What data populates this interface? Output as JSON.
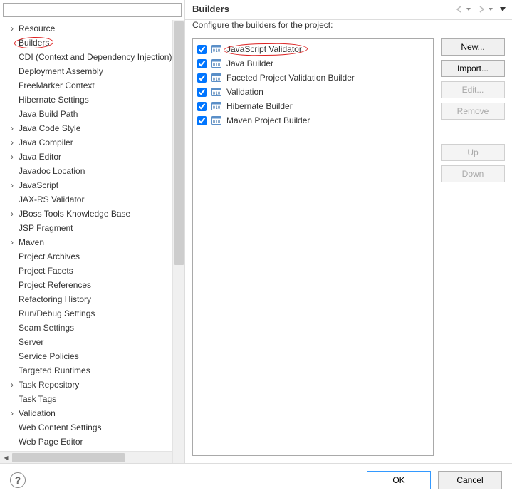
{
  "tree": {
    "filter_value": "",
    "items": [
      {
        "label": "Resource",
        "expandable": true
      },
      {
        "label": "Builders",
        "expandable": false,
        "highlighted": true
      },
      {
        "label": "CDI (Context and Dependency Injection)",
        "expandable": false
      },
      {
        "label": "Deployment Assembly",
        "expandable": false
      },
      {
        "label": "FreeMarker Context",
        "expandable": false
      },
      {
        "label": "Hibernate Settings",
        "expandable": false
      },
      {
        "label": "Java Build Path",
        "expandable": false
      },
      {
        "label": "Java Code Style",
        "expandable": true
      },
      {
        "label": "Java Compiler",
        "expandable": true
      },
      {
        "label": "Java Editor",
        "expandable": true
      },
      {
        "label": "Javadoc Location",
        "expandable": false
      },
      {
        "label": "JavaScript",
        "expandable": true
      },
      {
        "label": "JAX-RS Validator",
        "expandable": false
      },
      {
        "label": "JBoss Tools Knowledge Base",
        "expandable": true
      },
      {
        "label": "JSP Fragment",
        "expandable": false
      },
      {
        "label": "Maven",
        "expandable": true
      },
      {
        "label": "Project Archives",
        "expandable": false
      },
      {
        "label": "Project Facets",
        "expandable": false
      },
      {
        "label": "Project References",
        "expandable": false
      },
      {
        "label": "Refactoring History",
        "expandable": false
      },
      {
        "label": "Run/Debug Settings",
        "expandable": false
      },
      {
        "label": "Seam Settings",
        "expandable": false
      },
      {
        "label": "Server",
        "expandable": false
      },
      {
        "label": "Service Policies",
        "expandable": false
      },
      {
        "label": "Targeted Runtimes",
        "expandable": false
      },
      {
        "label": "Task Repository",
        "expandable": true
      },
      {
        "label": "Task Tags",
        "expandable": false
      },
      {
        "label": "Validation",
        "expandable": true
      },
      {
        "label": "Web Content Settings",
        "expandable": false
      },
      {
        "label": "Web Page Editor",
        "expandable": false
      }
    ]
  },
  "header": {
    "title": "Builders"
  },
  "config": {
    "description": "Configure the builders for the project:",
    "builders": [
      {
        "label": "JavaScript Validator",
        "checked": true,
        "highlighted": true
      },
      {
        "label": "Java Builder",
        "checked": true
      },
      {
        "label": "Faceted Project Validation Builder",
        "checked": true
      },
      {
        "label": "Validation",
        "checked": true
      },
      {
        "label": "Hibernate Builder",
        "checked": true
      },
      {
        "label": "Maven Project Builder",
        "checked": true
      }
    ]
  },
  "buttons": {
    "new": "New...",
    "import": "Import...",
    "edit": "Edit...",
    "remove": "Remove",
    "up": "Up",
    "down": "Down",
    "ok": "OK",
    "cancel": "Cancel"
  },
  "help_glyph": "?"
}
